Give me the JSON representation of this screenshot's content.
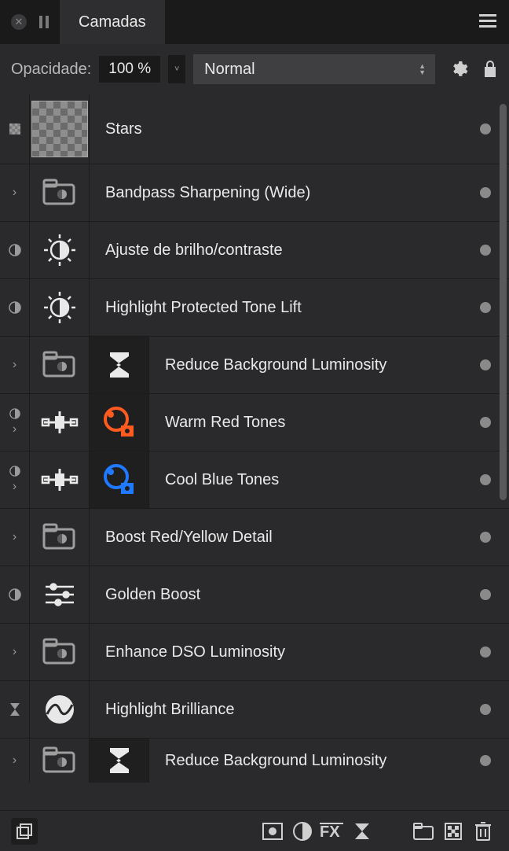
{
  "header": {
    "tab_title": "Camadas"
  },
  "controls": {
    "opacity_label": "Opacidade:",
    "opacity_value": "100 %",
    "blend_mode": "Normal"
  },
  "layers": [
    {
      "name": "Stars",
      "left_icon": "checker",
      "thumb": "checker-large",
      "glyph": null,
      "visible": true
    },
    {
      "name": "Bandpass Sharpening (Wide)",
      "left_icon": "expand",
      "thumb": "group",
      "glyph": null,
      "visible": true
    },
    {
      "name": "Ajuste de brilho/contraste",
      "left_icon": "adjust",
      "thumb": "sun",
      "glyph": null,
      "visible": true
    },
    {
      "name": "Highlight Protected Tone Lift",
      "left_icon": "adjust",
      "thumb": "sun",
      "glyph": null,
      "visible": true
    },
    {
      "name": "Reduce Background Luminosity",
      "left_icon": "expand",
      "thumb": "group",
      "glyph": "sigma",
      "visible": true
    },
    {
      "name": "Warm Red Tones",
      "left_icon": "adjust-expand",
      "thumb": "nodes",
      "glyph": "channel-red",
      "visible": true
    },
    {
      "name": "Cool Blue Tones",
      "left_icon": "adjust-expand",
      "thumb": "nodes",
      "glyph": "channel-blue",
      "visible": true
    },
    {
      "name": "Boost Red/Yellow Detail",
      "left_icon": "expand",
      "thumb": "group",
      "glyph": null,
      "visible": true
    },
    {
      "name": "Golden Boost",
      "left_icon": "adjust",
      "thumb": "sliders",
      "glyph": null,
      "visible": true
    },
    {
      "name": "Enhance DSO Luminosity",
      "left_icon": "expand",
      "thumb": "group",
      "glyph": null,
      "visible": true
    },
    {
      "name": "Highlight Brilliance",
      "left_icon": "hourglass",
      "thumb": "curve-circle",
      "glyph": null,
      "visible": true
    },
    {
      "name": "Reduce Background Luminosity",
      "left_icon": "expand",
      "thumb": "group",
      "glyph": "sigma",
      "visible": true
    }
  ]
}
